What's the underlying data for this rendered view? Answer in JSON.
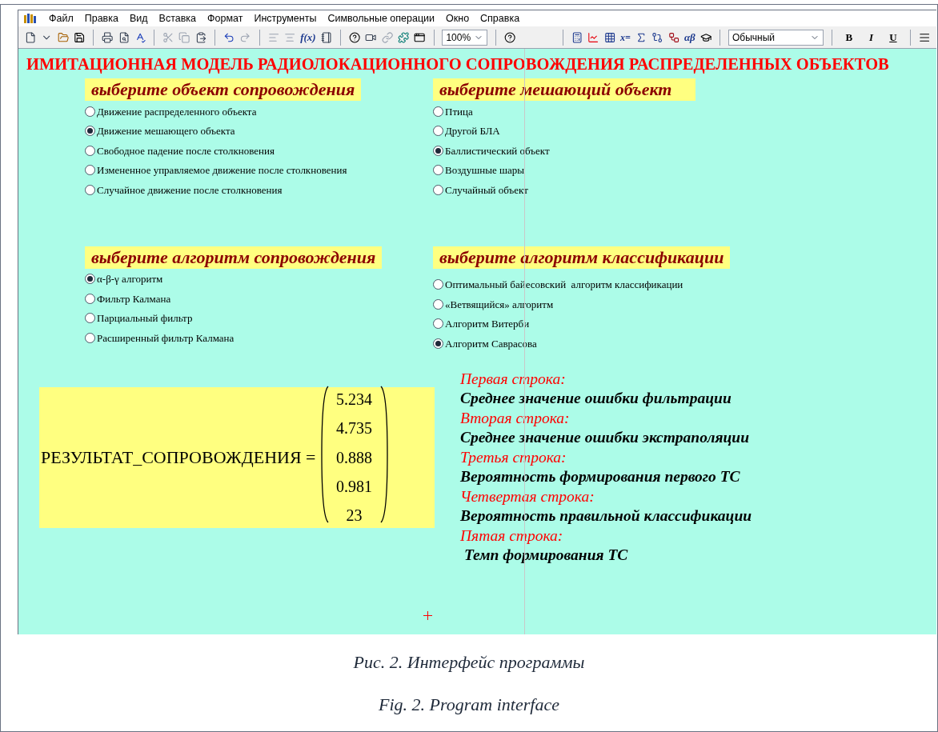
{
  "menu": [
    {
      "label": "Файл"
    },
    {
      "label": "Правка"
    },
    {
      "label": "Вид"
    },
    {
      "label": "Вставка"
    },
    {
      "label": "Формат"
    },
    {
      "label": "Инструменты"
    },
    {
      "label": "Символьные операции"
    },
    {
      "label": "Окно"
    },
    {
      "label": "Справка"
    }
  ],
  "toolbar": {
    "zoom": "100%",
    "style": "Обычный",
    "function_button": "f(x)",
    "evaluate_button": "x=",
    "greek_button": "αβ",
    "format_buttons": [
      {
        "label": "B",
        "kind": "bold"
      },
      {
        "label": "I",
        "kind": "italic"
      },
      {
        "label": "U",
        "kind": "underline"
      }
    ]
  },
  "worksheet": {
    "title": "ИМИТАЦИОННАЯ МОДЕЛЬ РАДИОЛОКАЦИОННОГО СОПРОВОЖДЕНИЯ РАСПРЕДЕЛЕННЫХ ОБЪЕКТОВ",
    "groups": [
      {
        "heading": "выберите объект сопровождения",
        "options": [
          {
            "label": "Движение распределенного объекта",
            "selected": false
          },
          {
            "label": "Движение мешающего объекта",
            "selected": true
          },
          {
            "label": "Свободное падение после столкновения",
            "selected": false
          },
          {
            "label": "Измененное управляемое движение после столкновения",
            "selected": false
          },
          {
            "label": "Случайное движение после столкновения",
            "selected": false
          }
        ]
      },
      {
        "heading": "выберите мешающий объект",
        "options": [
          {
            "label": "Птица",
            "selected": false
          },
          {
            "label": "Другой БЛА",
            "selected": false
          },
          {
            "label": "Баллистический объект",
            "selected": true
          },
          {
            "label": "Воздушные шары",
            "selected": false
          },
          {
            "label": "Случайный объект",
            "selected": false
          }
        ]
      },
      {
        "heading": "выберите алгоритм сопровождения",
        "options": [
          {
            "label": "α-β-γ алгоритм",
            "selected": true
          },
          {
            "label": "Фильтр Калмана",
            "selected": false
          },
          {
            "label": "Парциальный фильтр",
            "selected": false
          },
          {
            "label": "Расширенный фильтр Калмана",
            "selected": false
          }
        ]
      },
      {
        "heading": "выберите алгоритм классификации",
        "options": [
          {
            "label": "Оптимальный байесовский  алгоритм классификации",
            "selected": false
          },
          {
            "label": "«Ветвящийся» алгоритм",
            "selected": false
          },
          {
            "label": "Алгоритм Витерби",
            "selected": false
          },
          {
            "label": "Алгоритм Саврасова",
            "selected": true
          }
        ]
      }
    ],
    "result": {
      "name": "РЕЗУЛЬТАТ_СОПРОВОЖДЕНИЯ =",
      "values": [
        "5.234",
        "4.735",
        "0.888",
        "0.981",
        "23"
      ]
    },
    "legend": [
      {
        "heading": "Первая строка:",
        "text": "Среднее значение ошибки фильтрации"
      },
      {
        "heading": "Вторая строка:",
        "text": "Среднее значение ошибки экстраполяции"
      },
      {
        "heading": "Третья строка:",
        "text": "Вероятность формирования первого ТС"
      },
      {
        "heading": "Четвертая строка:",
        "text": "Вероятность правильной классификации"
      },
      {
        "heading": "Пятая строка:",
        "text": " Темп формирования ТС"
      }
    ]
  },
  "caption": {
    "ru": "Рис. 2. Интерфейс программы",
    "en": "Fig. 2. Program interface"
  }
}
